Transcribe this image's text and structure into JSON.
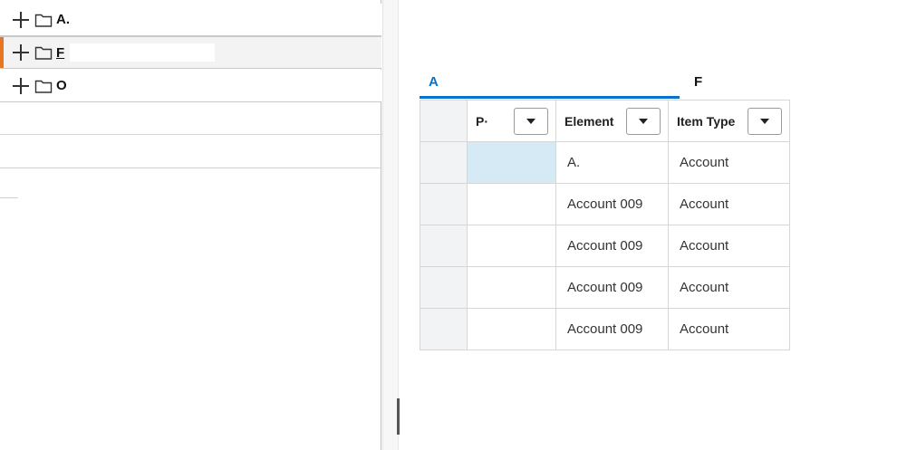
{
  "tree": {
    "items": [
      {
        "label": "A."
      },
      {
        "label": "F"
      },
      {
        "label": "O"
      }
    ]
  },
  "tabs": [
    {
      "label": "A",
      "active": true
    },
    {
      "label": "F",
      "active": false
    }
  ],
  "grid": {
    "columns": [
      {
        "label": "P·"
      },
      {
        "label": "Element"
      },
      {
        "label": "Item Type"
      }
    ],
    "rows": [
      {
        "element": "A.",
        "item_type": "Account"
      },
      {
        "element": "Account 009",
        "item_type": "Account"
      },
      {
        "element": "Account 009",
        "item_type": "Account"
      },
      {
        "element": "Account 009",
        "item_type": "Account"
      },
      {
        "element": "Account 009",
        "item_type": "Account"
      }
    ]
  },
  "colors": {
    "accent": "#0572ce",
    "selection_marker": "#e87722",
    "selected_cell": "#d6eaf5"
  }
}
